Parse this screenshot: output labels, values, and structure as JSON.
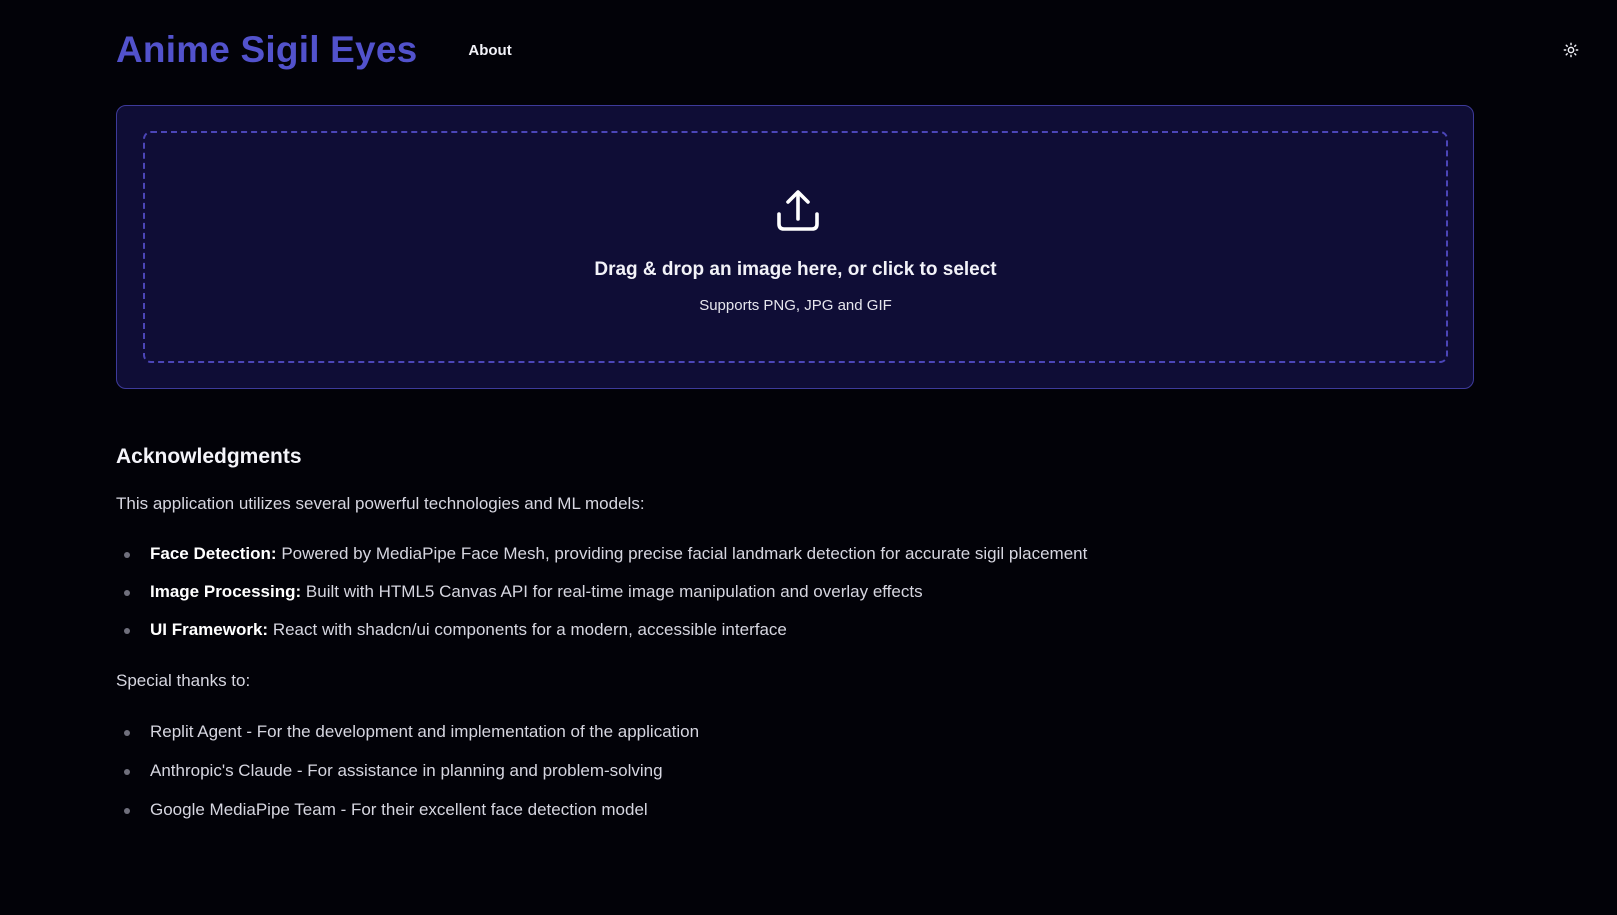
{
  "header": {
    "brand": "Anime Sigil Eyes",
    "nav_about": "About",
    "theme_toggle_icon": "sun-icon"
  },
  "upload": {
    "icon": "upload-icon",
    "title": "Drag & drop an image here, or click to select",
    "subtitle": "Supports PNG, JPG and GIF"
  },
  "acknowledgments": {
    "heading": "Acknowledgments",
    "intro": "This application utilizes several powerful technologies and ML models:",
    "technologies": [
      {
        "label": "Face Detection:",
        "text": " Powered by MediaPipe Face Mesh, providing precise facial landmark detection for accurate sigil placement"
      },
      {
        "label": "Image Processing:",
        "text": " Built with HTML5 Canvas API for real-time image manipulation and overlay effects"
      },
      {
        "label": "UI Framework:",
        "text": " React with shadcn/ui components for a modern, accessible interface"
      }
    ],
    "thanks_intro": "Special thanks to:",
    "thanks": [
      "Replit Agent - For the development and implementation of the application",
      "Anthropic's Claude - For assistance in planning and problem-solving",
      "Google MediaPipe Team - For their excellent face detection model"
    ]
  },
  "colors": {
    "background": "#020208",
    "brand": "#5252cc",
    "card": "#0f0d36",
    "card_border": "#3d3a9a",
    "dashed_border": "#4b45b8"
  }
}
